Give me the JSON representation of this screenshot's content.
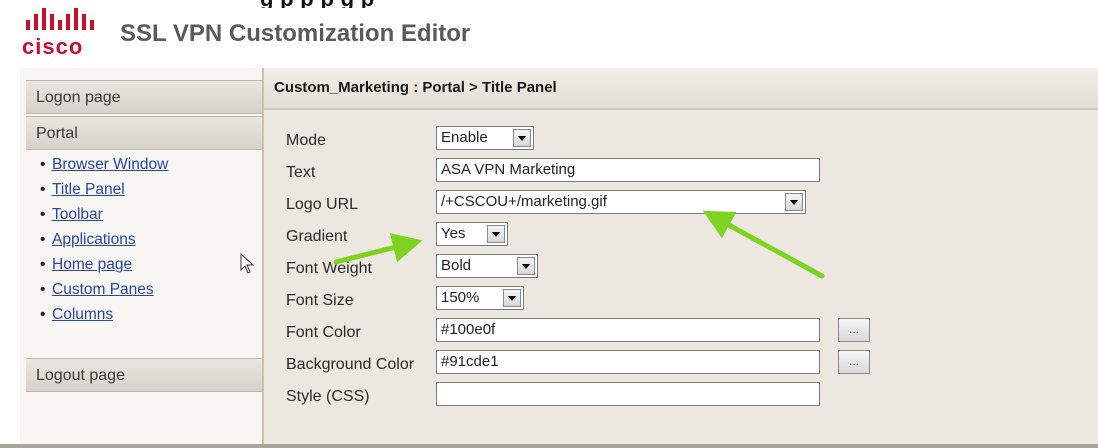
{
  "header": {
    "top_cut_text": "g    p      p    p            g       p",
    "logo_text": "cisco",
    "title": "SSL VPN Customization Editor"
  },
  "sidebar": {
    "logon": "Logon page",
    "portal": "Portal",
    "links": [
      "Browser Window",
      "Title Panel",
      "Toolbar",
      "Applications",
      "Home page",
      "Custom Panes",
      "Columns"
    ],
    "logout": "Logout page"
  },
  "content": {
    "breadcrumb": "Custom_Marketing : Portal > Title Panel",
    "fields": {
      "mode": {
        "label": "Mode",
        "value": "Enable"
      },
      "text": {
        "label": "Text",
        "value": "ASA VPN Marketing"
      },
      "logo_url": {
        "label": "Logo URL",
        "value": "/+CSCOU+/marketing.gif"
      },
      "gradient": {
        "label": "Gradient",
        "value": "Yes"
      },
      "font_weight": {
        "label": "Font Weight",
        "value": "Bold"
      },
      "font_size": {
        "label": "Font Size",
        "value": "150%"
      },
      "font_color": {
        "label": "Font Color",
        "value": "#100e0f"
      },
      "background_color": {
        "label": "Background Color",
        "value": "#91cde1"
      },
      "style_css": {
        "label": "Style (CSS)",
        "value": ""
      }
    },
    "picker_label": "..."
  },
  "colors": {
    "annotation_arrow": "#7ed321",
    "cisco_red": "#c8102e",
    "link_blue": "#2a44a8"
  },
  "icons": [
    "cisco-logo-icon",
    "mouse-pointer-icon",
    "dropdown-arrow-icon",
    "color-picker-icon",
    "annotation-arrow-icon"
  ]
}
